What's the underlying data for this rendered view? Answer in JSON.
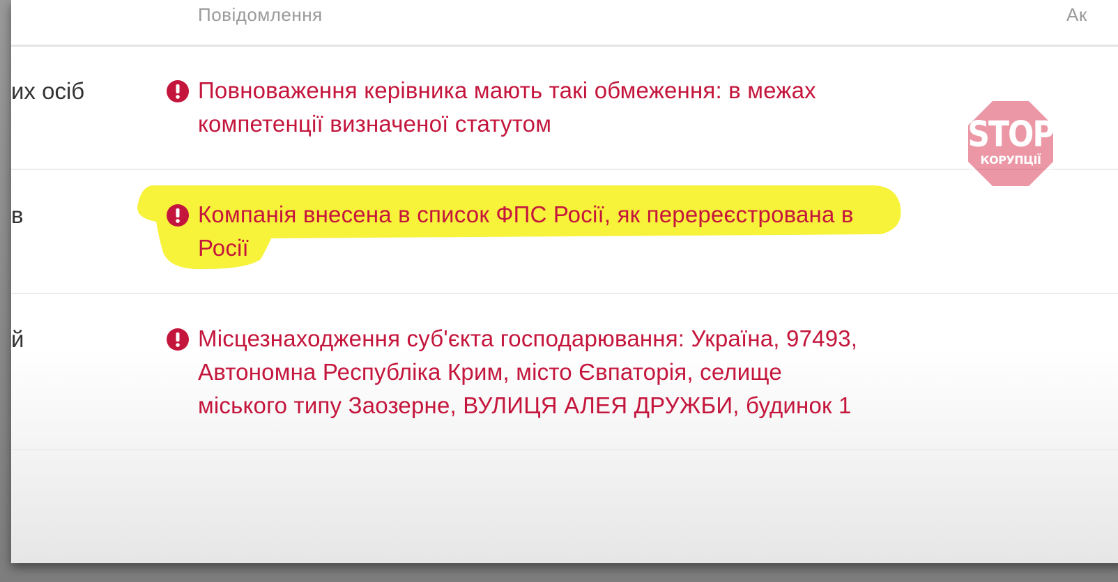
{
  "header": {
    "messages_column": "Повідомлення",
    "actions_column": "Ак"
  },
  "rows": [
    {
      "label": "их осіб",
      "icon": "exclamation-circle-icon",
      "message_lines": [
        "Повноваження керівника мають такі обмеження: в межах",
        "компетенції визначеної статутом"
      ]
    },
    {
      "label": "в",
      "icon": "exclamation-circle-icon",
      "highlighted": true,
      "message_lines": [
        "Компанія внесена в список ФПС Росії, як перереєстрована в",
        "Росії"
      ]
    },
    {
      "label": "й",
      "icon": "exclamation-circle-icon",
      "message_lines": [
        "Місцезнаходження суб'єкта господарювання: Україна, 97493,",
        "Автономна Республіка Крим, місто Євпаторія, селище",
        "міського типу Заозерне, ВУЛИЦЯ АЛЕЯ ДРУЖБИ, будинок 1"
      ]
    }
  ],
  "watermark": {
    "title": "STOP",
    "subtitle": "КОРУПЦІЇ"
  },
  "colors": {
    "message_text": "#c4163c",
    "icon": "#c4163c",
    "highlight": "#f7f23a",
    "header_text": "#9a9a9a"
  }
}
